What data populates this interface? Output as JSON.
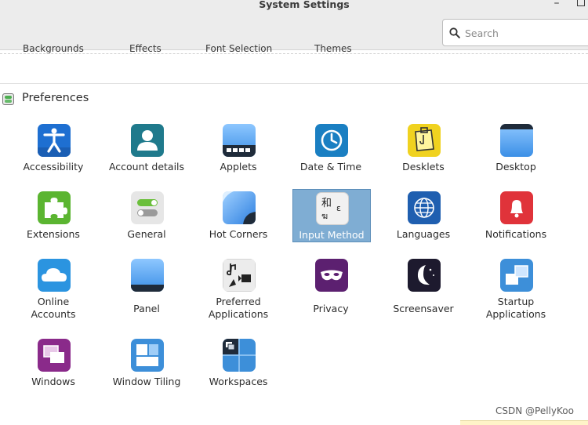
{
  "window": {
    "title": "System Settings",
    "minimize_glyph": "–"
  },
  "search": {
    "placeholder": "Search",
    "value": ""
  },
  "previous_section": {
    "items": [
      "Backgrounds",
      "Effects",
      "Font Selection",
      "Themes"
    ]
  },
  "preferences": {
    "title": "Preferences",
    "items": [
      {
        "label": "Accessibility",
        "icon": "accessibility-icon"
      },
      {
        "label": "Account details",
        "icon": "account-details-icon"
      },
      {
        "label": "Applets",
        "icon": "applets-icon"
      },
      {
        "label": "Date & Time",
        "icon": "date-time-icon"
      },
      {
        "label": "Desklets",
        "icon": "desklets-icon"
      },
      {
        "label": "Desktop",
        "icon": "desktop-icon"
      },
      {
        "label": "Extensions",
        "icon": "extensions-icon"
      },
      {
        "label": "General",
        "icon": "general-icon"
      },
      {
        "label": "Hot Corners",
        "icon": "hot-corners-icon"
      },
      {
        "label": "Input Method",
        "icon": "input-method-icon",
        "selected": true,
        "glyph_top": "和",
        "glyph_bottom": "ฆ",
        "glyph_side": "ε"
      },
      {
        "label": "Languages",
        "icon": "languages-icon"
      },
      {
        "label": "Notifications",
        "icon": "notifications-icon"
      },
      {
        "label": "Online\nAccounts",
        "line1": "Online",
        "line2": "Accounts",
        "icon": "online-accounts-icon"
      },
      {
        "label": "Panel",
        "icon": "panel-icon"
      },
      {
        "label": "Preferred\nApplications",
        "line1": "Preferred",
        "line2": "Applications",
        "icon": "preferred-applications-icon"
      },
      {
        "label": "Privacy",
        "icon": "privacy-icon"
      },
      {
        "label": "Screensaver",
        "icon": "screensaver-icon"
      },
      {
        "label": "Startup\nApplications",
        "line1": "Startup",
        "line2": "Applications",
        "icon": "startup-applications-icon"
      },
      {
        "label": "Windows",
        "icon": "windows-icon"
      },
      {
        "label": "Window Tiling",
        "icon": "window-tiling-icon"
      },
      {
        "label": "Workspaces",
        "icon": "workspaces-icon"
      }
    ]
  },
  "watermark": "CSDN @PellyKoo",
  "colors": {
    "selection": "#7fadd3",
    "titlebar": "#ececec"
  }
}
